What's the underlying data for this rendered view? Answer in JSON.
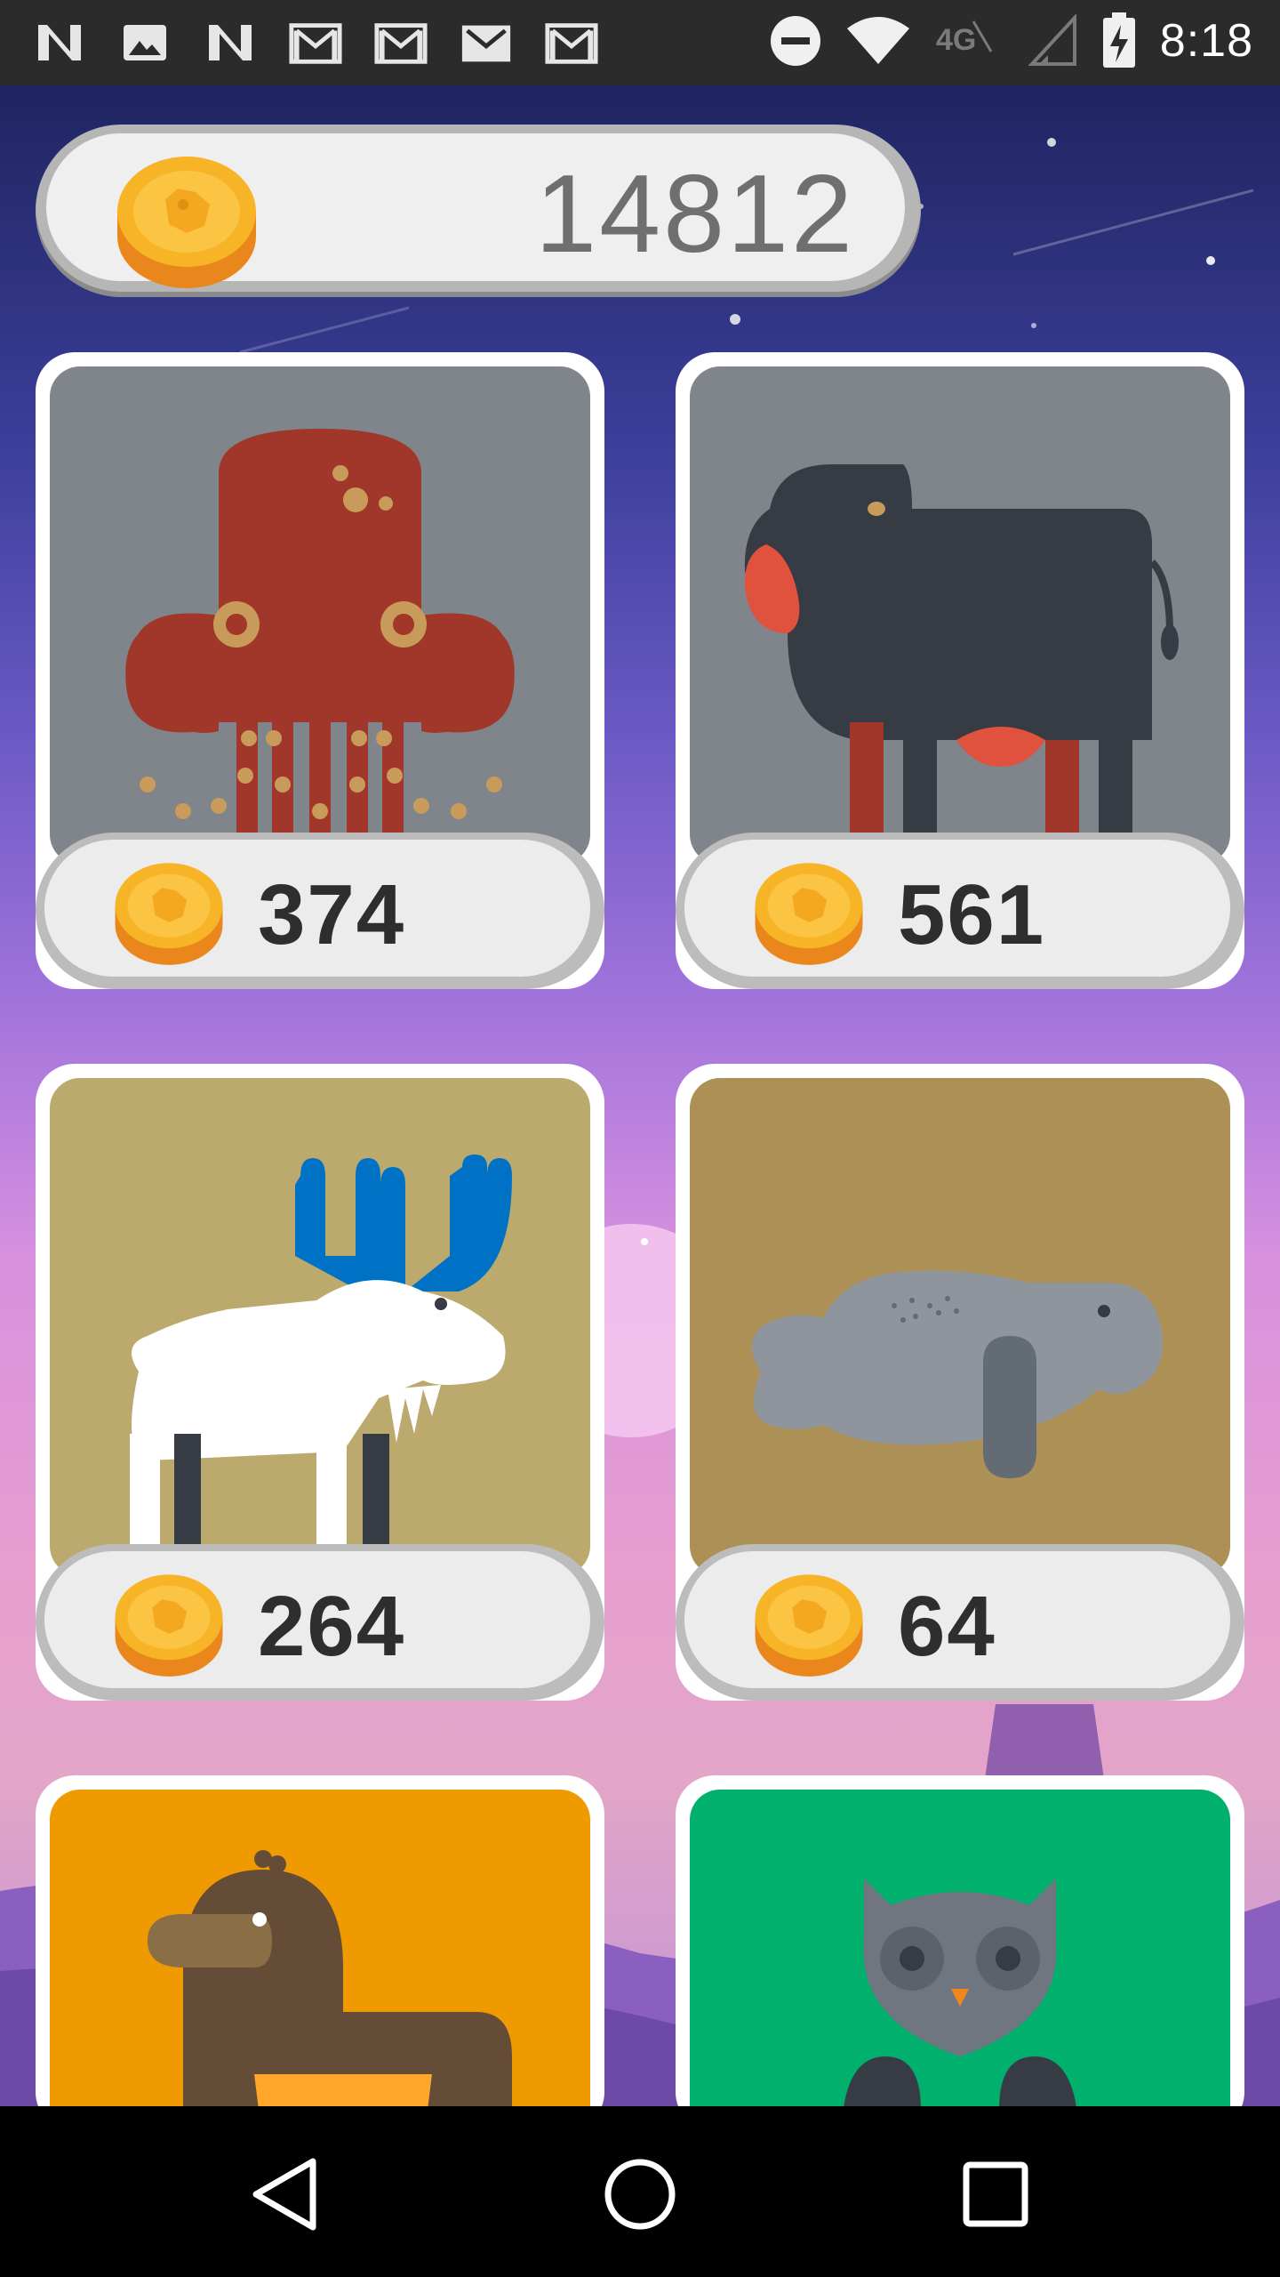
{
  "status_bar": {
    "time": "8:18",
    "network": "4G",
    "notification_icons": [
      "n-icon",
      "image-icon",
      "n-icon",
      "gmail-icon",
      "gmail-icon",
      "gmail-icon",
      "gmail-icon"
    ],
    "right_icons": [
      "do-not-disturb-icon",
      "wifi-icon",
      "lte-icon",
      "signal-icon",
      "battery-charging-icon"
    ]
  },
  "wallet": {
    "coins": "14812"
  },
  "cards": [
    {
      "animal": "octopus",
      "price": "374",
      "bg": "#7f858b"
    },
    {
      "animal": "cow",
      "price": "561",
      "bg": "#7f858b"
    },
    {
      "animal": "moose",
      "price": "264",
      "bg": "#bca96e"
    },
    {
      "animal": "manatee",
      "price": "64",
      "bg": "#ad9055"
    },
    {
      "animal": "platypus",
      "price": "",
      "bg": "#ef9a00"
    },
    {
      "animal": "owl",
      "price": "",
      "bg": "#00b06c"
    }
  ],
  "colors": {
    "coin": "#f8b427",
    "coin_rim": "#e9871c",
    "pill": "#ececec"
  },
  "nav": [
    "back-icon",
    "home-icon",
    "recents-icon"
  ]
}
